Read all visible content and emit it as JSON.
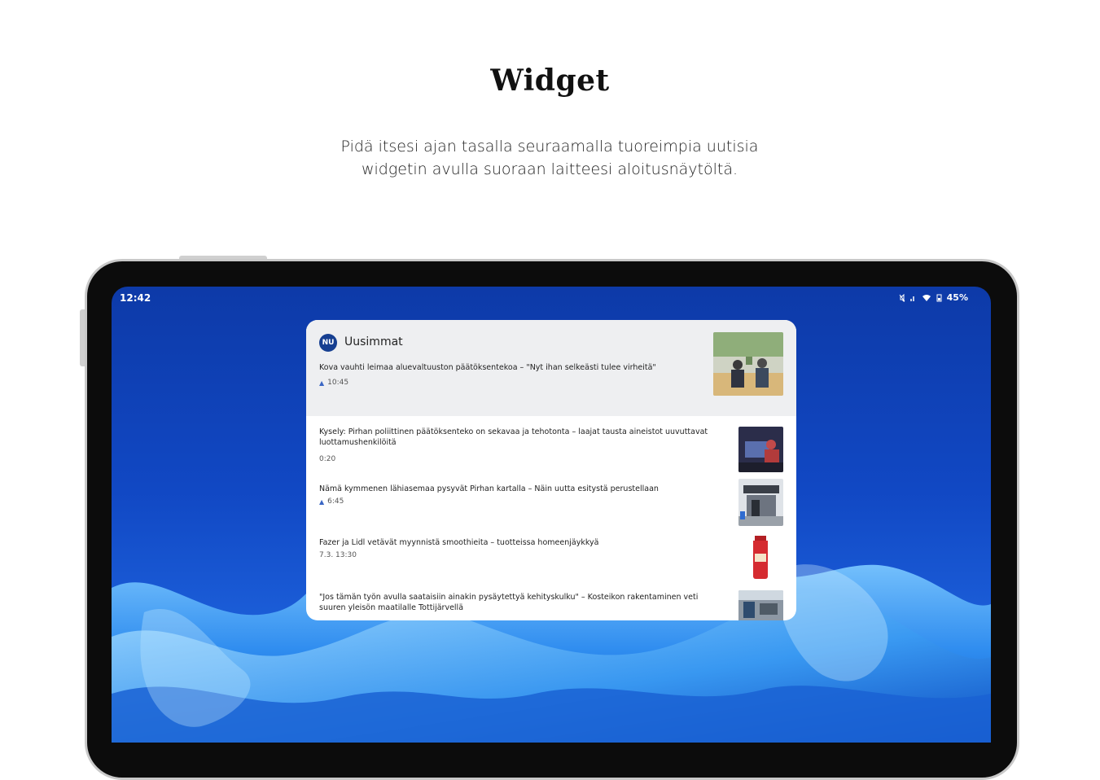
{
  "heading": {
    "title": "Widget",
    "subtitle_line1": "Pidä itsesi ajan tasalla seuraamalla tuoreimpia uutisia",
    "subtitle_line2": "widgetin avulla suoraan laitteesi aloitusnäytöltä."
  },
  "status_bar": {
    "time": "12:42",
    "battery": "45%"
  },
  "widget": {
    "brand_initials": "NU",
    "brand_name": "Uusimmat",
    "top_story": {
      "headline": "Kova vauhti leimaa aluevaltuuston päätöksentekoa – \"Nyt ihan selkeästi tulee virheitä\"",
      "time": "10:45",
      "starred": true
    },
    "items": [
      {
        "headline": "Kysely: Pirhan poliittinen päätöksenteko on sekavaa ja tehotonta – laajat tausta aineistot uuvuttavat luottamushenkilöitä",
        "time": "0:20",
        "starred": false
      },
      {
        "headline": "Nämä kymmenen lähiasemaa pysyvät Pirhan kartalla – Näin uutta esitystä perustellaan",
        "time": "6:45",
        "starred": true
      },
      {
        "headline": "Fazer ja Lidl vetävät myynnistä smoothieita – tuotteissa homeenjäykkyä",
        "time": "7.3. 13:30",
        "starred": false
      },
      {
        "headline": "\"Jos tämän työn avulla saataisiin ainakin pysäytettyä kehityskulku\" – Kosteikon rakentaminen veti suuren yleisön maatilalle Tottijärvellä",
        "time": "",
        "starred": false
      }
    ]
  },
  "colors": {
    "brand": "#163f91",
    "wallpaper": "#1148c4",
    "widget_header_bg": "#eeeff1"
  }
}
